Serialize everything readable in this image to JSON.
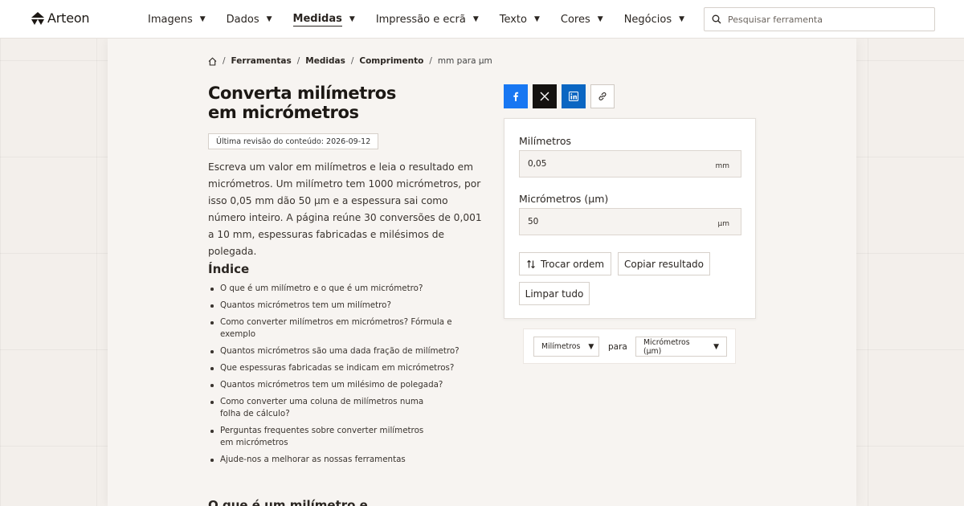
{
  "header": {
    "logo_text": "Arteon",
    "nav": [
      {
        "label": "Imagens",
        "active": false
      },
      {
        "label": "Dados",
        "active": false
      },
      {
        "label": "Medidas",
        "active": true
      },
      {
        "label": "Impressão e ecrã",
        "active": false
      },
      {
        "label": "Texto",
        "active": false
      },
      {
        "label": "Cores",
        "active": false
      },
      {
        "label": "Negócios",
        "active": false
      }
    ],
    "search_placeholder": "Pesquisar ferramenta"
  },
  "breadcrumb": {
    "items": [
      "Ferramentas",
      "Medidas",
      "Comprimento"
    ],
    "current": "mm para µm"
  },
  "page": {
    "title_line1": "Converta milímetros",
    "title_line2": "em micrómetros",
    "revision": "Última revisão do conteúdo: 2026-09-12",
    "intro": "Escreva um valor em milímetros e leia o resultado em micrómetros. Um milímetro tem 1000 micrómetros, por isso 0,05 mm dão 50 µm e a espessura sai como número inteiro. A página reúne 30 conversões de 0,001 a 10 mm, espessuras fabricadas e milésimos de polegada.",
    "toc_heading": "Índice",
    "toc": [
      "O que é um milímetro e o que é um micrómetro?",
      "Quantos micrómetros tem um milímetro?",
      "Como converter milímetros em micrómetros? Fórmula e exemplo",
      "Quantos micrómetros são uma dada fração de milímetro?",
      "Que espessuras fabricadas se indicam em micrómetros?",
      "Quantos micrómetros tem um milésimo de polegada?",
      "Como converter uma coluna de milímetros numa folha de cálculo?",
      "Perguntas frequentes sobre converter milímetros em micrómetros",
      "Ajude-nos a melhorar as nossas ferramentas"
    ],
    "next_heading": "O que é um milímetro e"
  },
  "share": {
    "icons": [
      "facebook-icon",
      "x-icon",
      "linkedin-icon",
      "link-icon"
    ]
  },
  "converter": {
    "from_label": "Milímetros",
    "from_value": "0,05",
    "from_unit": "mm",
    "to_label": "Micrómetros (µm)",
    "to_value": "50",
    "to_unit": "µm",
    "swap_label": "Trocar ordem",
    "copy_label": "Copiar resultado",
    "clear_label": "Limpar tudo",
    "from_select": "Milímetros",
    "para_label": "para",
    "to_select": "Micrómetros (µm)"
  },
  "colors": {
    "facebook": "#1877f2",
    "x": "#141210",
    "linkedin": "#0a66c2",
    "background": "#f3efeb"
  }
}
